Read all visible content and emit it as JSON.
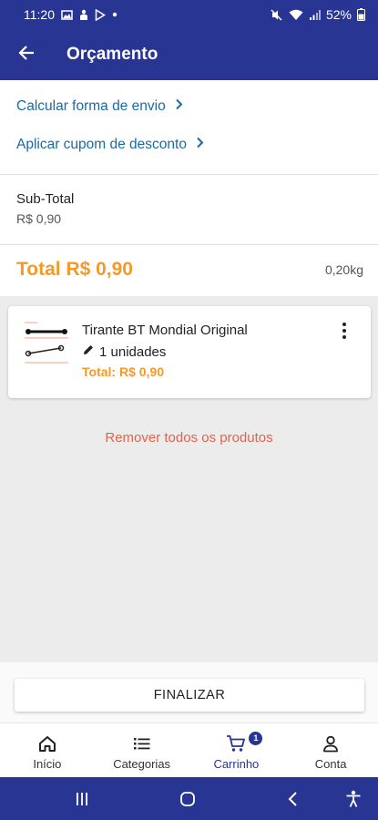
{
  "status_bar": {
    "time": "11:20",
    "battery": "52%"
  },
  "app_bar": {
    "title": "Orçamento"
  },
  "summary": {
    "shipping_link": "Calcular forma de envio",
    "coupon_link": "Aplicar cupom de desconto",
    "subtotal_label": "Sub-Total",
    "subtotal_value": "R$ 0,90",
    "total": "Total R$ 0,90",
    "weight": "0,20kg"
  },
  "cart_items": [
    {
      "name": "Tirante BT Mondial Original",
      "quantity": "1 unidades",
      "total": "Total: R$ 0,90"
    }
  ],
  "remove_all_label": "Remover todos os produtos",
  "finalize_label": "FINALIZAR",
  "bottom_nav": {
    "items": [
      {
        "label": "Início",
        "icon": "home-icon"
      },
      {
        "label": "Categorias",
        "icon": "list-icon"
      },
      {
        "label": "Carrinho",
        "icon": "cart-icon",
        "badge": "1"
      },
      {
        "label": "Conta",
        "icon": "person-icon"
      }
    ],
    "active": "Carrinho"
  },
  "colors": {
    "primary": "#283593",
    "link": "#1a6aa3",
    "accent_orange": "#f39a2a",
    "danger": "#e5624b",
    "background": "#ececec"
  }
}
